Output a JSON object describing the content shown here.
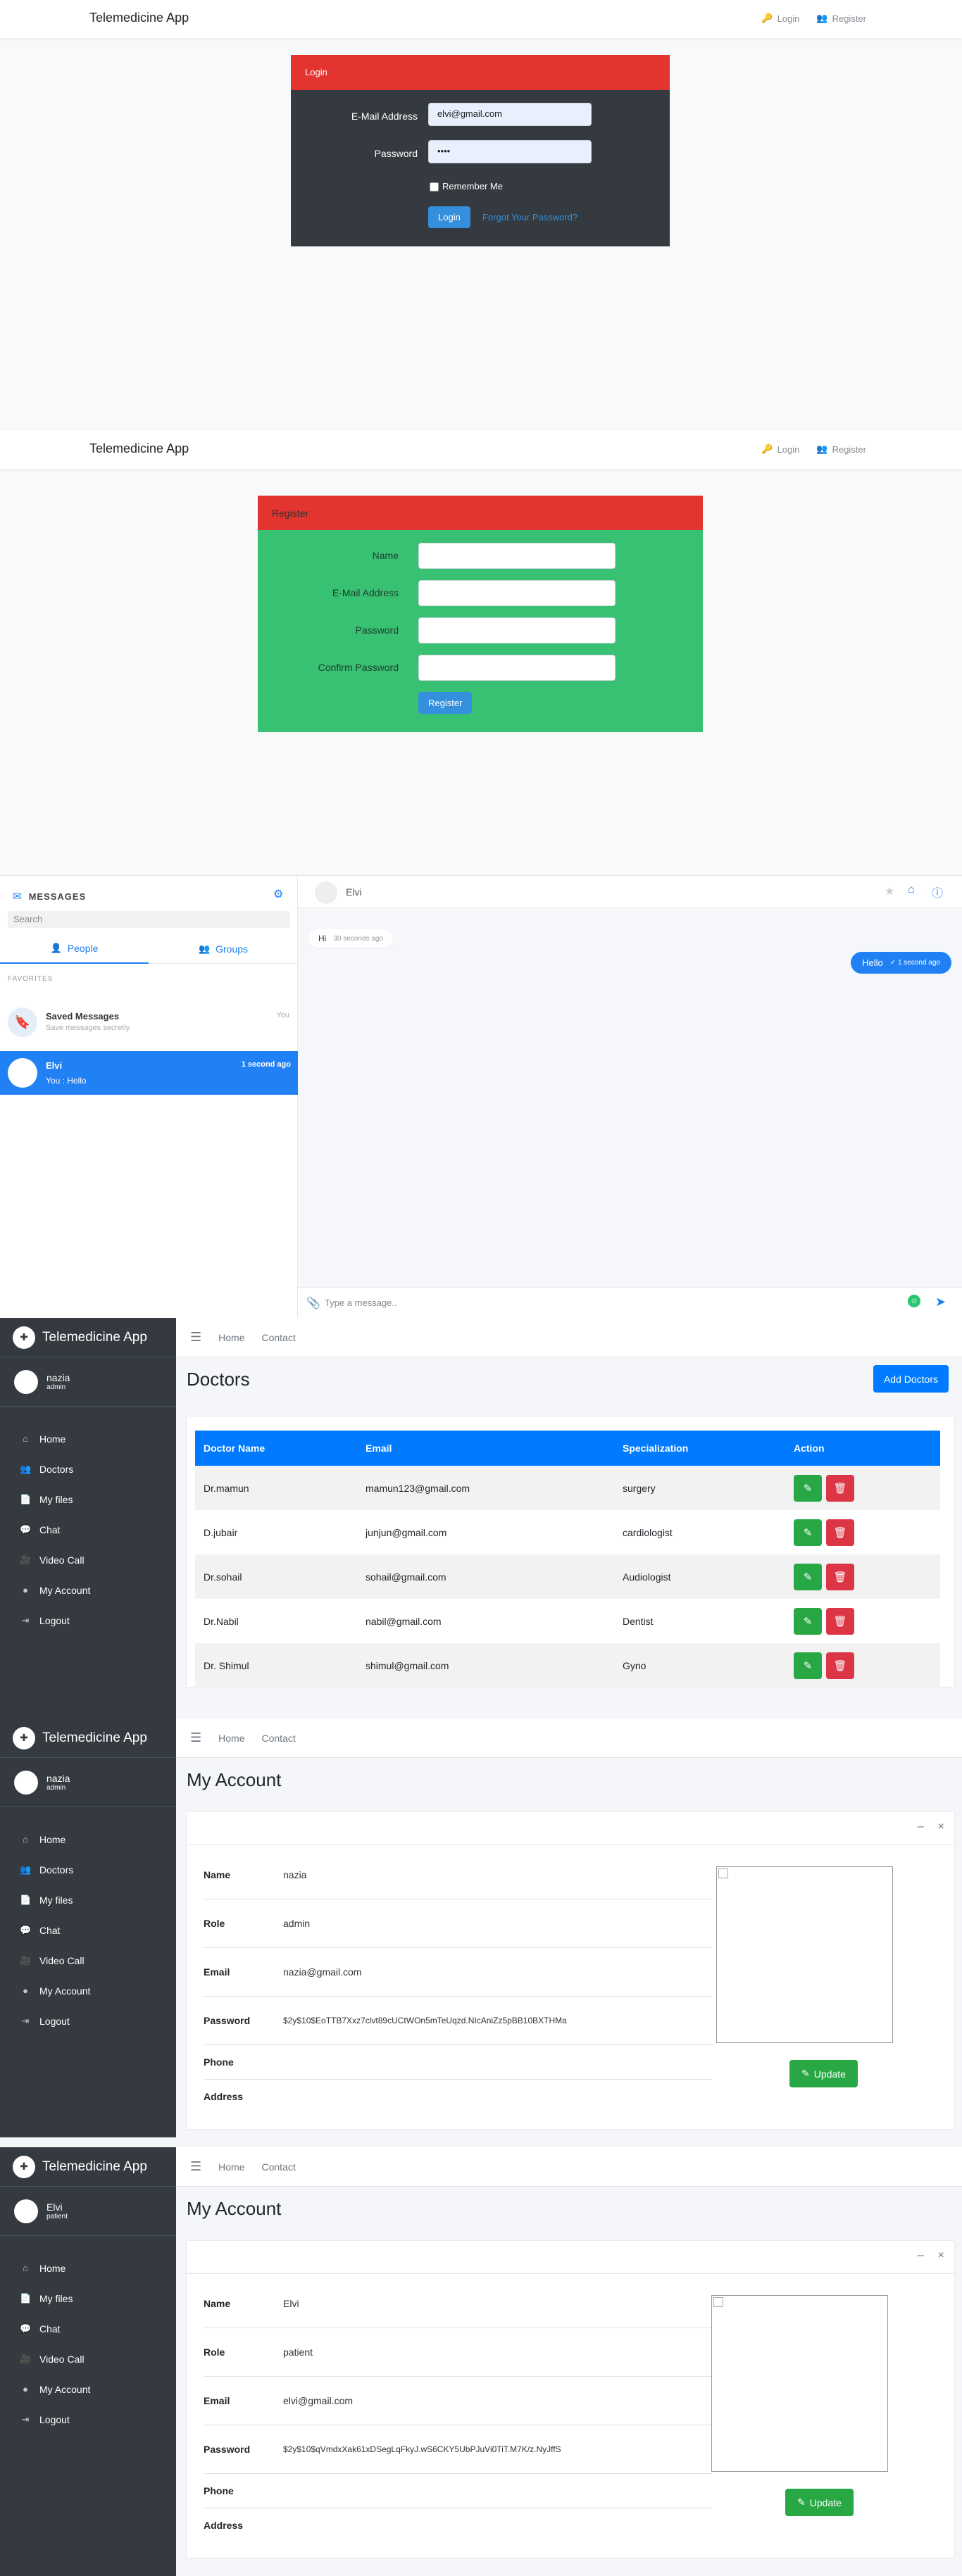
{
  "login": {
    "brand": "Telemedicine App",
    "nav_login": "Login",
    "nav_register": "Register",
    "card_title": "Login",
    "email_label": "E-Mail Address",
    "email_value": "elvi@gmail.com",
    "password_label": "Password",
    "password_value": "••••",
    "remember_label": "Remember Me",
    "submit_label": "Login",
    "forgot_label": "Forgot Your Password?"
  },
  "register": {
    "brand": "Telemedicine App",
    "nav_login": "Login",
    "nav_register": "Register",
    "card_title": "Register",
    "name_label": "Name",
    "email_label": "E-Mail Address",
    "password_label": "Password",
    "confirm_label": "Confirm Password",
    "submit_label": "Register"
  },
  "chat": {
    "header_title": "MESSAGES",
    "search_placeholder": "Search",
    "tab_people": "People",
    "tab_groups": "Groups",
    "favorites_label": "FAVORITES",
    "saved": {
      "title": "Saved Messages",
      "subtitle": "Save messages secretly",
      "tag": "You"
    },
    "contact": {
      "name": "Elvi",
      "time": "1 second ago",
      "preview": "You : Hello"
    },
    "conversation_name": "Elvi",
    "incoming": {
      "text": "Hi",
      "time": "30 seconds ago"
    },
    "outgoing": {
      "text": "Hello",
      "time": "1 second ago"
    },
    "input_placeholder": "Type a message.."
  },
  "doctors_page": {
    "brand": "Telemedicine App",
    "user_name": "nazia",
    "user_role": "admin",
    "nav": [
      "Home",
      "Doctors",
      "My files",
      "Chat",
      "Video Call",
      "My Account",
      "Logout"
    ],
    "top_links": [
      "Home",
      "Contact"
    ],
    "title": "Doctors",
    "add_button": "Add Doctors",
    "columns": [
      "Doctor Name",
      "Email",
      "Specialization",
      "Action"
    ],
    "rows": [
      {
        "name": "Dr.mamun",
        "email": "mamun123@gmail.com",
        "spec": "surgery"
      },
      {
        "name": "D.jubair",
        "email": "junjun@gmail.com",
        "spec": "cardiologist"
      },
      {
        "name": "Dr.sohail",
        "email": "sohail@gmail.com",
        "spec": "Audiologist"
      },
      {
        "name": "Dr.Nabil",
        "email": "nabil@gmail.com",
        "spec": "Dentist"
      },
      {
        "name": "Dr. Shimul",
        "email": "shimul@gmail.com",
        "spec": "Gyno"
      }
    ]
  },
  "admin_account": {
    "brand": "Telemedicine App",
    "user_name": "nazia",
    "user_role": "admin",
    "nav": [
      "Home",
      "Doctors",
      "My files",
      "Chat",
      "Video Call",
      "My Account",
      "Logout"
    ],
    "top_links": [
      "Home",
      "Contact"
    ],
    "title": "My Account",
    "fields": [
      {
        "k": "Name",
        "v": "nazia"
      },
      {
        "k": "Role",
        "v": "admin"
      },
      {
        "k": "Email",
        "v": "nazia@gmail.com"
      },
      {
        "k": "Password",
        "v": "$2y$10$EoTTB7Xxz7clvt89cUCtWOn5mTeUqzd.NIcAniZz5pBB10BXTHMa"
      },
      {
        "k": "Phone",
        "v": ""
      },
      {
        "k": "Address",
        "v": ""
      }
    ],
    "update_button": "Update"
  },
  "patient_account": {
    "brand": "Telemedicine App",
    "user_name": "Elvi",
    "user_role": "patient",
    "nav": [
      "Home",
      "My files",
      "Chat",
      "Video Call",
      "My Account",
      "Logout"
    ],
    "top_links": [
      "Home",
      "Contact"
    ],
    "title": "My Account",
    "fields": [
      {
        "k": "Name",
        "v": "Elvi"
      },
      {
        "k": "Role",
        "v": "patient"
      },
      {
        "k": "Email",
        "v": "elvi@gmail.com"
      },
      {
        "k": "Password",
        "v": "$2y$10$qVmdxXak61xDSegLqFkyJ.wS6CKY5UbPJuVi0TiT.M7K/z.NyJffS"
      },
      {
        "k": "Phone",
        "v": ""
      },
      {
        "k": "Address",
        "v": ""
      }
    ],
    "update_button": "Update"
  }
}
